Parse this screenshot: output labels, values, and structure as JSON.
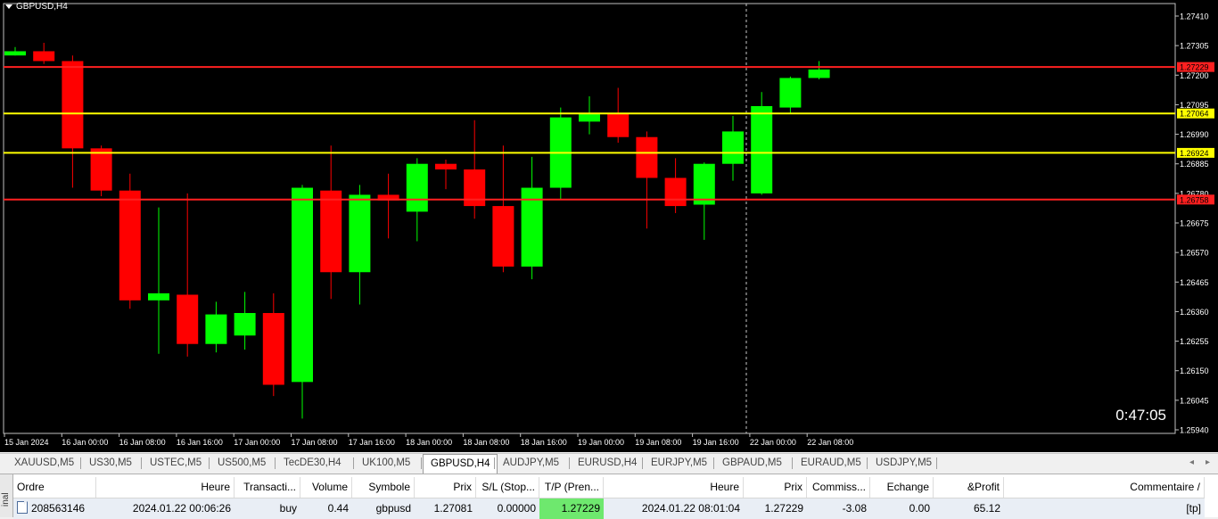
{
  "chart": {
    "title": "GBPUSD,H4",
    "countdown": "0:47:05",
    "colors": {
      "background": "#000000",
      "bull": "#00ff00",
      "bear": "#ff0000",
      "red_line": "#ff2020",
      "yellow_line": "#ffff00",
      "axis_text": "#ffffff"
    },
    "price_levels": [
      "1.27410",
      "1.27305",
      "1.27200",
      "1.27095",
      "1.26990",
      "1.26885",
      "1.26780",
      "1.26675",
      "1.26570",
      "1.26465",
      "1.26360",
      "1.26255",
      "1.26150",
      "1.26045",
      "1.25940"
    ],
    "time_labels": [
      "15 Jan 2024",
      "16 Jan 00:00",
      "16 Jan 08:00",
      "16 Jan 16:00",
      "17 Jan 00:00",
      "17 Jan 08:00",
      "17 Jan 16:00",
      "18 Jan 00:00",
      "18 Jan 08:00",
      "18 Jan 16:00",
      "19 Jan 00:00",
      "19 Jan 08:00",
      "19 Jan 16:00",
      "22 Jan 00:00",
      "22 Jan 08:00"
    ],
    "horizontal_lines": [
      {
        "price": 1.27229,
        "color": "#ff2020",
        "label": "1.27229"
      },
      {
        "price": 1.27064,
        "color": "#ffff00",
        "label": "1.27064"
      },
      {
        "price": 1.26924,
        "color": "#ffff00",
        "label": "1.26924"
      },
      {
        "price": 1.26758,
        "color": "#ff2020",
        "label": "1.26758"
      }
    ],
    "crosshair_time": "22 Jan 00:00"
  },
  "chart_data": {
    "type": "candlestick",
    "symbol": "GBPUSD",
    "timeframe": "H4",
    "ylim": [
      1.2594,
      1.2746
    ],
    "candles": [
      {
        "o": 1.2727,
        "h": 1.273,
        "l": 1.2727,
        "c": 1.27285
      },
      {
        "o": 1.27285,
        "h": 1.27315,
        "l": 1.2724,
        "c": 1.2725
      },
      {
        "o": 1.2725,
        "h": 1.2727,
        "l": 1.268,
        "c": 1.2694
      },
      {
        "o": 1.2694,
        "h": 1.2695,
        "l": 1.2677,
        "c": 1.2679
      },
      {
        "o": 1.2679,
        "h": 1.2685,
        "l": 1.2637,
        "c": 1.264
      },
      {
        "o": 1.264,
        "h": 1.2673,
        "l": 1.2621,
        "c": 1.26425
      },
      {
        "o": 1.2642,
        "h": 1.2678,
        "l": 1.262,
        "c": 1.26245
      },
      {
        "o": 1.26245,
        "h": 1.26395,
        "l": 1.26215,
        "c": 1.2635
      },
      {
        "o": 1.26275,
        "h": 1.2643,
        "l": 1.26225,
        "c": 1.26355
      },
      {
        "o": 1.26355,
        "h": 1.26425,
        "l": 1.2606,
        "c": 1.261
      },
      {
        "o": 1.2611,
        "h": 1.2681,
        "l": 1.2598,
        "c": 1.268
      },
      {
        "o": 1.2679,
        "h": 1.2695,
        "l": 1.26405,
        "c": 1.265
      },
      {
        "o": 1.265,
        "h": 1.2681,
        "l": 1.26385,
        "c": 1.26775
      },
      {
        "o": 1.26775,
        "h": 1.2685,
        "l": 1.2662,
        "c": 1.26755
      },
      {
        "o": 1.26715,
        "h": 1.26905,
        "l": 1.2661,
        "c": 1.26885
      },
      {
        "o": 1.26885,
        "h": 1.269,
        "l": 1.26795,
        "c": 1.26865
      },
      {
        "o": 1.26865,
        "h": 1.2704,
        "l": 1.2669,
        "c": 1.26735
      },
      {
        "o": 1.26735,
        "h": 1.2695,
        "l": 1.265,
        "c": 1.2652
      },
      {
        "o": 1.2652,
        "h": 1.2691,
        "l": 1.26475,
        "c": 1.268
      },
      {
        "o": 1.268,
        "h": 1.27085,
        "l": 1.2676,
        "c": 1.2705
      },
      {
        "o": 1.27035,
        "h": 1.27125,
        "l": 1.2699,
        "c": 1.27065
      },
      {
        "o": 1.27065,
        "h": 1.27155,
        "l": 1.2696,
        "c": 1.2698
      },
      {
        "o": 1.2698,
        "h": 1.27,
        "l": 1.26655,
        "c": 1.26835
      },
      {
        "o": 1.26835,
        "h": 1.26905,
        "l": 1.2671,
        "c": 1.26735
      },
      {
        "o": 1.2674,
        "h": 1.2689,
        "l": 1.26615,
        "c": 1.26885
      },
      {
        "o": 1.26885,
        "h": 1.27055,
        "l": 1.26825,
        "c": 1.27
      },
      {
        "o": 1.2678,
        "h": 1.2714,
        "l": 1.26775,
        "c": 1.2709
      },
      {
        "o": 1.27085,
        "h": 1.27195,
        "l": 1.27065,
        "c": 1.2719
      },
      {
        "o": 1.2719,
        "h": 1.2725,
        "l": 1.27185,
        "c": 1.2722
      }
    ]
  },
  "tabs": {
    "items": [
      "XAUUSD,M5",
      "US30,M5",
      "USTEC,M5",
      "US500,M5",
      "TecDE30,H4",
      "UK100,M5",
      "GBPUSD,H4",
      "AUDJPY,M5",
      "EURUSD,H4",
      "EURJPY,M5",
      "GBPAUD,M5",
      "EURAUD,M5",
      "USDJPY,M5"
    ],
    "active": "GBPUSD,H4",
    "left_arrow": "◂",
    "right_arrow": "▸"
  },
  "terminal": {
    "side_label": "inal",
    "columns": [
      "Ordre",
      "Heure",
      "Transacti...",
      "Volume",
      "Symbole",
      "Prix",
      "S/L (Stop...",
      "T/P (Pren...",
      "Heure",
      "Prix",
      "Commiss...",
      "Echange",
      "&Profit",
      "Commentaire"
    ],
    "sort_indicator": "/",
    "row": [
      "208563146",
      "2024.01.22 00:06:26",
      "buy",
      "0.44",
      "gbpusd",
      "1.27081",
      "0.00000",
      "1.27229",
      "2024.01.22 08:01:04",
      "1.27229",
      "-3.08",
      "0.00",
      "65.12",
      "[tp]"
    ]
  }
}
